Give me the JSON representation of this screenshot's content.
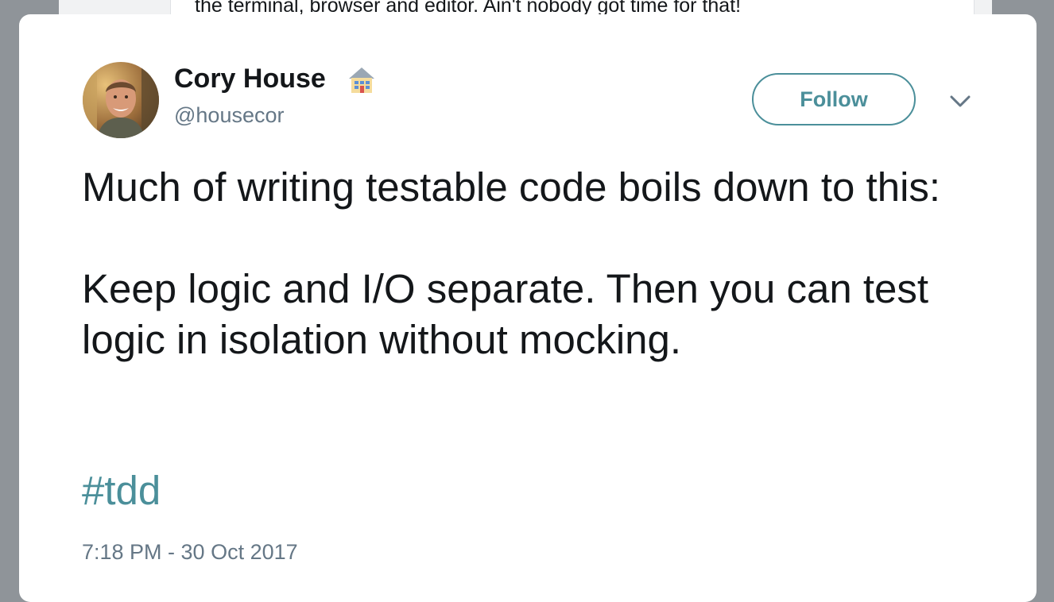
{
  "background": {
    "text": "the terminal, browser and editor. Ain't nobody got time for that!"
  },
  "tweet": {
    "author_name": "Cory House",
    "author_emoji_icon": "house-icon",
    "handle": "@housecor",
    "follow_label": "Follow",
    "menu_icon": "chevron-down-icon",
    "text_lines": [
      "Much of writing testable code boils down to this:",
      "Keep logic and I/O separate. Then you can test logic in isolation without mocking."
    ],
    "hashtag": "#tdd",
    "timestamp": "7:18 PM - 30 Oct 2017"
  },
  "colors": {
    "accent": "#4b8f9a",
    "text": "#14171a",
    "muted": "#657786",
    "overlay": "#8f9499"
  }
}
